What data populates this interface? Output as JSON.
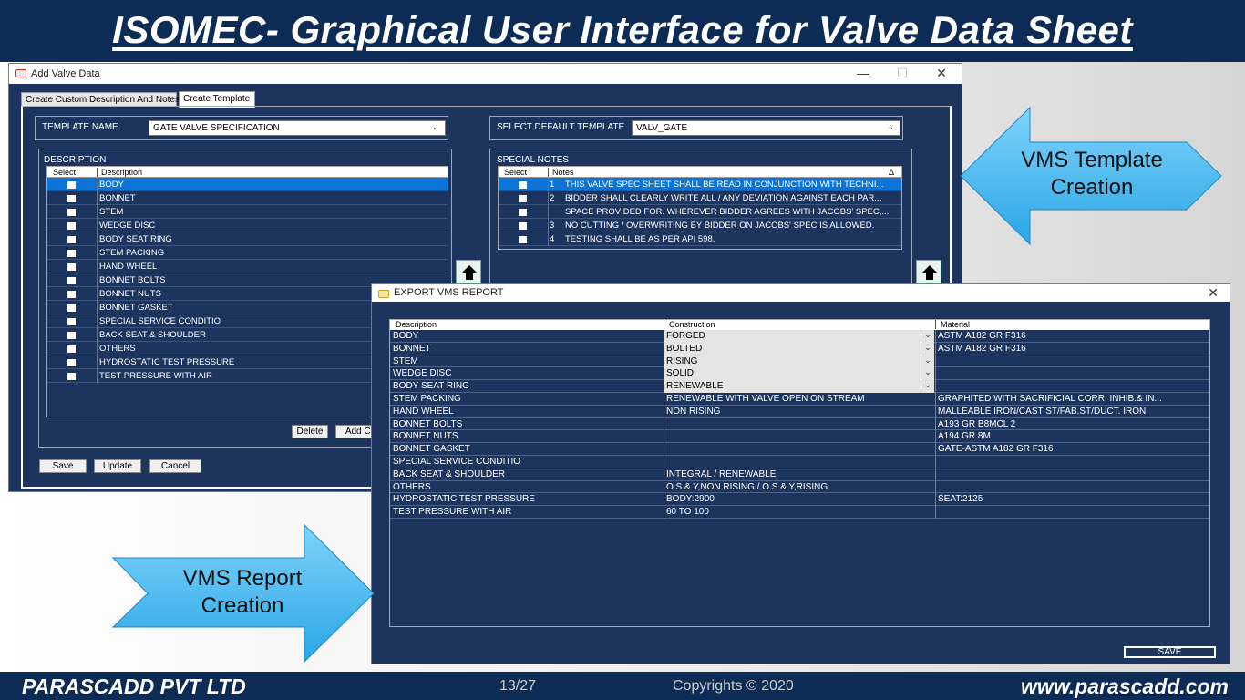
{
  "slide": {
    "title": "ISOMEC- Graphical User Interface for Valve Data Sheet",
    "footer_company": "PARASCADD PVT LTD",
    "footer_page": "13/27",
    "footer_copyright": "Copyrights © 2020",
    "footer_url": "www.parascadd.com"
  },
  "callouts": {
    "template_line1": "VMS Template",
    "template_line2": "Creation",
    "report_line1": "VMS Report",
    "report_line2": "Creation"
  },
  "add_valve_window": {
    "title": "Add Valve Data",
    "controls": {
      "minimize": "—",
      "maximize": "☐",
      "close": "✕"
    },
    "tabs": [
      "Create Custom Description And Notes",
      "Create Template"
    ],
    "active_tab": 1,
    "template_name_label": "TEMPLATE NAME",
    "template_name_value": "GATE VALVE SPECIFICATION",
    "default_template_label": "SELECT DEFAULT TEMPLATE",
    "default_template_value": "VALV_GATE",
    "description_group": "DESCRIPTION",
    "description_columns": [
      "Select",
      "Description"
    ],
    "description_rows": [
      "BODY",
      "BONNET",
      "STEM",
      "WEDGE DISC",
      "BODY SEAT RING",
      "STEM PACKING",
      "HAND WHEEL",
      "BONNET BOLTS",
      "BONNET NUTS",
      "BONNET GASKET",
      "SPECIAL SERVICE CONDITIO",
      "BACK SEAT & SHOULDER",
      "OTHERS",
      "HYDROSTATIC TEST PRESSURE",
      "TEST PRESSURE WITH AIR"
    ],
    "description_selected_index": 0,
    "special_notes_group": "SPECIAL NOTES",
    "notes_columns": [
      "Select",
      "Notes"
    ],
    "notes_sort_glyph": "Δ",
    "notes_rows": [
      {
        "num": "1",
        "text": "THIS VALVE SPEC SHEET SHALL BE READ IN CONJUNCTION  WITH TECHNI..."
      },
      {
        "num": "2",
        "text": "BIDDER SHALL CLEARLY WRITE ALL / ANY DEVIATION AGAINST EACH PAR..."
      },
      {
        "num": "",
        "text": "SPACE PROVIDED FOR. WHEREVER BIDDER AGREES WITH JACOBS' SPEC,..."
      },
      {
        "num": "3",
        "text": "NO CUTTING / OVERWRITING BY BIDDER ON JACOBS' SPEC IS ALLOWED."
      },
      {
        "num": "4",
        "text": "TESTING SHALL BE AS PER API 598."
      }
    ],
    "notes_selected_index": 0,
    "delete_label": "Delete",
    "add_custom_label": "Add Cus",
    "save_label": "Save",
    "update_label": "Update",
    "cancel_label": "Cancel"
  },
  "export_window": {
    "title": "EXPORT VMS REPORT",
    "close": "✕",
    "columns": [
      "Description",
      "Construction",
      "Material"
    ],
    "rows": [
      {
        "description": "BODY",
        "construction": "FORGED",
        "material": "ASTM A182 GR F316",
        "dropdown": true
      },
      {
        "description": "BONNET",
        "construction": "BOLTED",
        "material": "ASTM A182 GR F316",
        "dropdown": true
      },
      {
        "description": "STEM",
        "construction": "RISING",
        "material": "",
        "dropdown": true
      },
      {
        "description": "WEDGE DISC",
        "construction": "SOLID",
        "material": "",
        "dropdown": true
      },
      {
        "description": "BODY SEAT RING",
        "construction": "RENEWABLE",
        "material": "",
        "dropdown": true
      },
      {
        "description": "STEM PACKING",
        "construction": "RENEWABLE WITH VALVE OPEN ON STREAM",
        "material": "GRAPHITED WITH SACRIFICIAL CORR. INHIB.& IN...",
        "dropdown": false
      },
      {
        "description": "HAND WHEEL",
        "construction": "NON RISING",
        "material": "MALLEABLE IRON/CAST ST/FAB.ST/DUCT. IRON",
        "dropdown": false
      },
      {
        "description": "BONNET BOLTS",
        "construction": "",
        "material": "A193 GR B8MCL 2",
        "dropdown": false
      },
      {
        "description": "BONNET NUTS",
        "construction": "",
        "material": "A194 GR 8M",
        "dropdown": false
      },
      {
        "description": "BONNET GASKET",
        "construction": "",
        "material": "GATE-ASTM A182 GR F316",
        "dropdown": false
      },
      {
        "description": "SPECIAL SERVICE CONDITIO",
        "construction": "",
        "material": "",
        "dropdown": false
      },
      {
        "description": "BACK SEAT & SHOULDER",
        "construction": "INTEGRAL / RENEWABLE",
        "material": "",
        "dropdown": false
      },
      {
        "description": "OTHERS",
        "construction": "O.S & Y,NON RISING / O.S & Y,RISING",
        "material": "",
        "dropdown": false
      },
      {
        "description": "HYDROSTATIC TEST PRESSURE",
        "construction": "BODY:2900",
        "material": "SEAT:2125",
        "dropdown": false
      },
      {
        "description": "TEST PRESSURE WITH AIR",
        "construction": "60 TO 100",
        "material": "",
        "dropdown": false
      }
    ],
    "save_label": "SAVE"
  },
  "colors": {
    "window_bg": "#1d355e",
    "header_bar": "#0c2b55",
    "selection": "#0b74d6",
    "callout_arrow": "#39b8f0"
  }
}
